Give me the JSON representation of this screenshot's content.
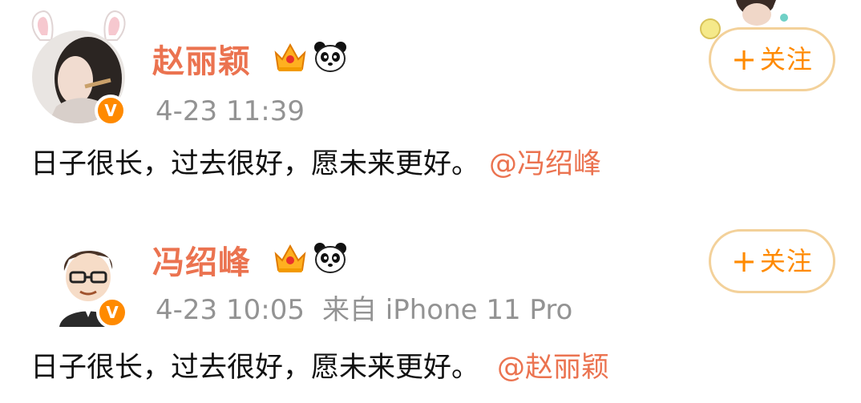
{
  "posts": [
    {
      "username": "赵丽颖",
      "time": "4-23 11:39",
      "source": "",
      "text": "日子很长，过去很好，愿未来更好。",
      "mention": "@冯绍峰",
      "follow_plus": "+",
      "follow_label": "关注"
    },
    {
      "username": "冯绍峰",
      "time": "4-23 10:05",
      "source": "来自 iPhone 11 Pro",
      "text": "日子很长，过去很好，愿未来更好。",
      "mention": "@赵丽颖",
      "follow_plus": "+",
      "follow_label": "关注"
    }
  ],
  "colors": {
    "username": "#eb7350",
    "mention": "#eb7350",
    "meta": "#939393",
    "follow_accent": "#ff8a00",
    "follow_border": "#f3d19a",
    "verified_badge": "#ff8a00"
  },
  "icons": {
    "verified": "verified-v-icon",
    "vip": "crown-icon",
    "fan_badge": "panda-icon"
  }
}
